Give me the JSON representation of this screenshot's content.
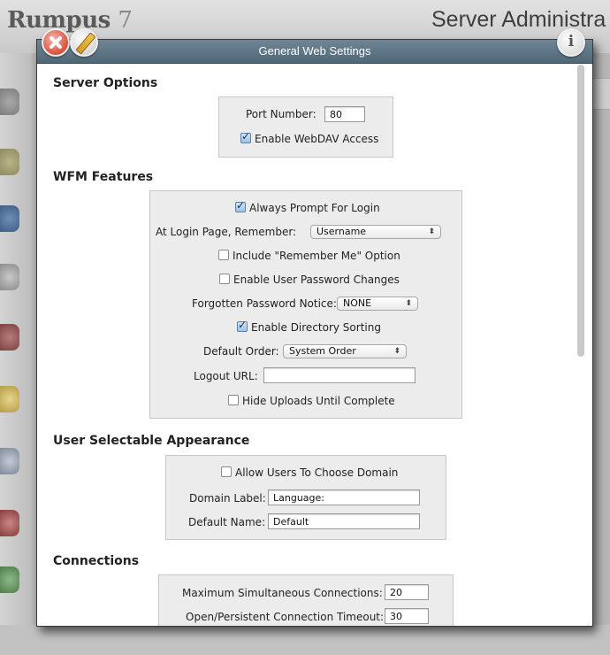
{
  "app": {
    "logo_name": "Rumpus",
    "logo_version": "7",
    "title": "Server Administra"
  },
  "dialog": {
    "title": "General Web Settings"
  },
  "server_options": {
    "heading": "Server Options",
    "port_label": "Port Number:",
    "port_value": "80",
    "webdav_label": "Enable WebDAV Access",
    "webdav_checked": true
  },
  "wfm_features": {
    "heading": "WFM Features",
    "always_prompt_label": "Always Prompt For Login",
    "always_prompt_checked": true,
    "remember_label": "At Login Page, Remember:",
    "remember_value": "Username",
    "remember_me_label": "Include \"Remember Me\" Option",
    "remember_me_checked": false,
    "password_changes_label": "Enable User Password Changes",
    "password_changes_checked": false,
    "forgotten_label": "Forgotten Password Notice:",
    "forgotten_value": "NONE",
    "dir_sorting_label": "Enable Directory Sorting",
    "dir_sorting_checked": true,
    "default_order_label": "Default Order:",
    "default_order_value": "System Order",
    "logout_label": "Logout URL:",
    "logout_value": "",
    "hide_uploads_label": "Hide Uploads Until Complete",
    "hide_uploads_checked": false
  },
  "appearance": {
    "heading": "User Selectable Appearance",
    "allow_domain_label": "Allow Users To Choose Domain",
    "allow_domain_checked": false,
    "domain_label_label": "Domain Label:",
    "domain_label_value": "Language:",
    "default_name_label": "Default Name:",
    "default_name_value": "Default"
  },
  "connections": {
    "heading": "Connections",
    "max_label": "Maximum Simultaneous Connections:",
    "max_value": "20",
    "timeout_label": "Open/Persistent Connection Timeout:",
    "timeout_value": "30"
  },
  "colors": {
    "titlebar": "#5a7282",
    "group_box": "#ececec"
  }
}
